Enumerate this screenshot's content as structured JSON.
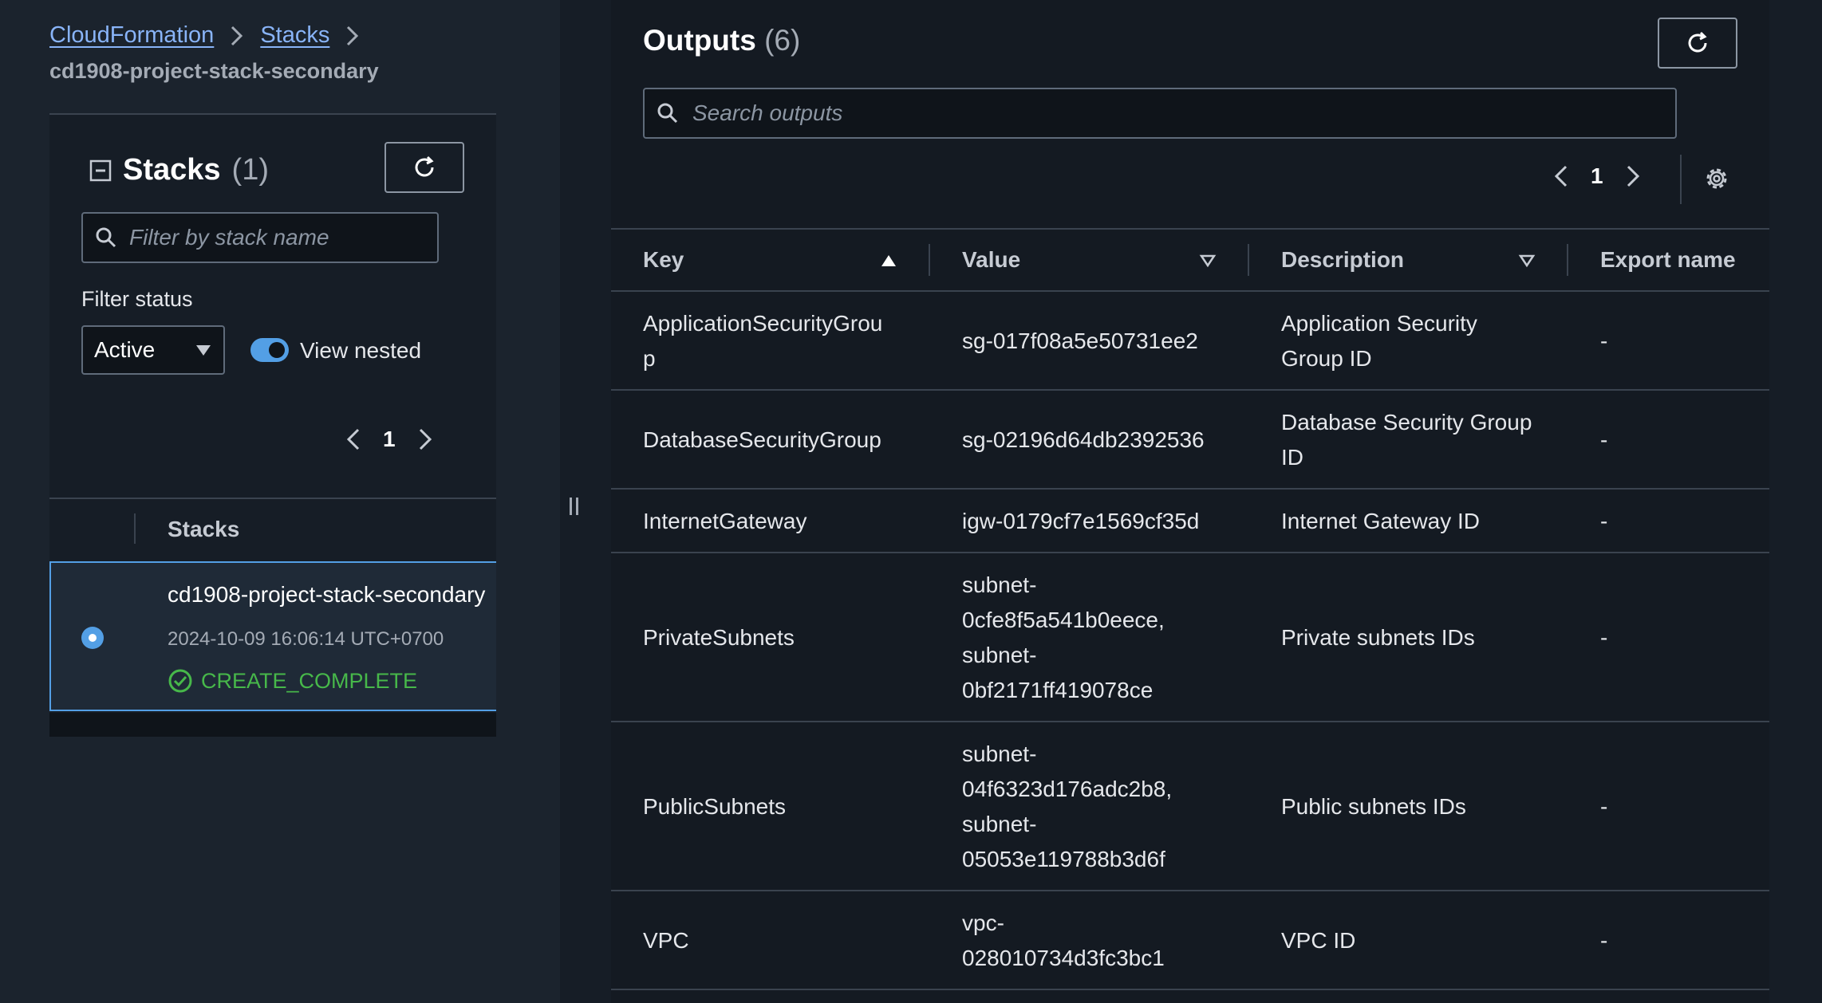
{
  "breadcrumb": {
    "items": [
      "CloudFormation",
      "Stacks"
    ],
    "current": "cd1908-project-stack-secondary"
  },
  "stacks_panel": {
    "title": "Stacks",
    "count": "(1)",
    "filter_placeholder": "Filter by stack name",
    "filter_status_label": "Filter status",
    "status_selected": "Active",
    "view_nested_label": "View nested",
    "view_nested_on": true,
    "page": "1",
    "column_header": "Stacks",
    "stack": {
      "name": "cd1908-project-stack-secondary",
      "date": "2024-10-09 16:06:14 UTC+0700",
      "status": "CREATE_COMPLETE",
      "status_color": "#47b84a",
      "selected": true
    }
  },
  "outputs": {
    "title": "Outputs",
    "count": "(6)",
    "search_placeholder": "Search outputs",
    "page": "1",
    "columns": {
      "key": "Key",
      "value": "Value",
      "description": "Description",
      "export_name": "Export name"
    },
    "rows": [
      {
        "key": "ApplicationSecurityGrou\np",
        "value": "sg-017f08a5e50731ee2",
        "description": "Application Security\nGroup ID",
        "export_name": "-"
      },
      {
        "key": "DatabaseSecurityGroup",
        "value": "sg-02196d64db2392536",
        "description": "Database Security Group\nID",
        "export_name": "-"
      },
      {
        "key": "InternetGateway",
        "value": "igw-0179cf7e1569cf35d",
        "description": "Internet Gateway ID",
        "export_name": "-"
      },
      {
        "key": "PrivateSubnets",
        "value": "subnet-\n0cfe8f5a541b0eece,\nsubnet-\n0bf2171ff419078ce",
        "description": "Private subnets IDs",
        "export_name": "-"
      },
      {
        "key": "PublicSubnets",
        "value": "subnet-\n04f6323d176adc2b8,\nsubnet-\n05053e119788b3d6f",
        "description": "Public subnets IDs",
        "export_name": "-"
      },
      {
        "key": "VPC",
        "value": "vpc-\n028010734d3fc3bc1",
        "description": "VPC ID",
        "export_name": "-"
      }
    ]
  },
  "colors": {
    "link": "#89b4f8",
    "accent": "#539fe5",
    "success": "#47b84a"
  }
}
